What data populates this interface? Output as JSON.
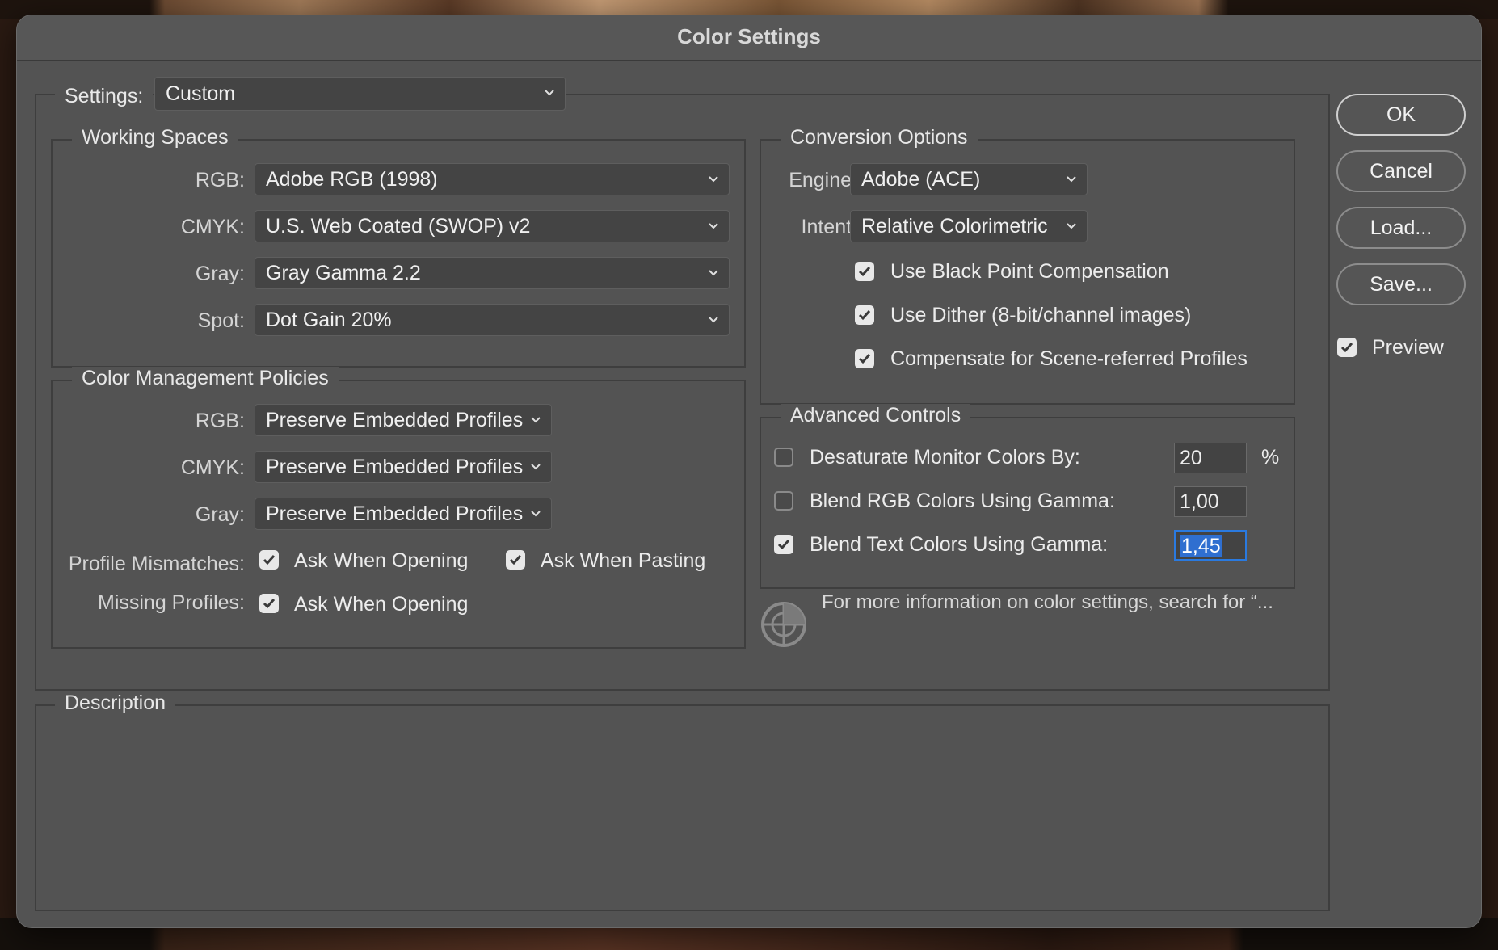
{
  "window": {
    "title": "Color Settings"
  },
  "settings": {
    "label": "Settings:",
    "value": "Custom"
  },
  "working_spaces": {
    "legend": "Working Spaces",
    "rows": [
      {
        "label": "RGB:",
        "value": "Adobe RGB (1998)"
      },
      {
        "label": "CMYK:",
        "value": "U.S. Web Coated (SWOP) v2"
      },
      {
        "label": "Gray:",
        "value": "Gray Gamma 2.2"
      },
      {
        "label": "Spot:",
        "value": "Dot Gain 20%"
      }
    ]
  },
  "policies": {
    "legend": "Color Management Policies",
    "rows": [
      {
        "label": "RGB:",
        "value": "Preserve Embedded Profiles"
      },
      {
        "label": "CMYK:",
        "value": "Preserve Embedded Profiles"
      },
      {
        "label": "Gray:",
        "value": "Preserve Embedded Profiles"
      }
    ],
    "profile_mismatches": {
      "label": "Profile Mismatches:",
      "ask_opening": {
        "label": "Ask When Opening",
        "checked": true
      },
      "ask_pasting": {
        "label": "Ask When Pasting",
        "checked": true
      }
    },
    "missing_profiles": {
      "label": "Missing Profiles:",
      "ask_opening": {
        "label": "Ask When Opening",
        "checked": true
      }
    }
  },
  "conversion": {
    "legend": "Conversion Options",
    "engine": {
      "label": "Engine:",
      "value": "Adobe (ACE)"
    },
    "intent": {
      "label": "Intent:",
      "value": "Relative Colorimetric"
    },
    "options": [
      {
        "label": "Use Black Point Compensation",
        "checked": true
      },
      {
        "label": "Use Dither (8-bit/channel images)",
        "checked": true
      },
      {
        "label": "Compensate for Scene-referred Profiles",
        "checked": true
      }
    ]
  },
  "advanced": {
    "legend": "Advanced Controls",
    "desaturate": {
      "label": "Desaturate Monitor Colors By:",
      "value": "20",
      "unit": "%",
      "checked": false
    },
    "blend_rgb": {
      "label": "Blend RGB Colors Using Gamma:",
      "value": "1,00",
      "checked": false
    },
    "blend_text": {
      "label": "Blend Text Colors Using Gamma:",
      "value": "1,45",
      "checked": true
    }
  },
  "info": {
    "text": "For more information on color settings, search for “..."
  },
  "description": {
    "legend": "Description"
  },
  "buttons": {
    "ok": "OK",
    "cancel": "Cancel",
    "load": "Load...",
    "save": "Save..."
  },
  "preview": {
    "label": "Preview",
    "checked": true
  }
}
